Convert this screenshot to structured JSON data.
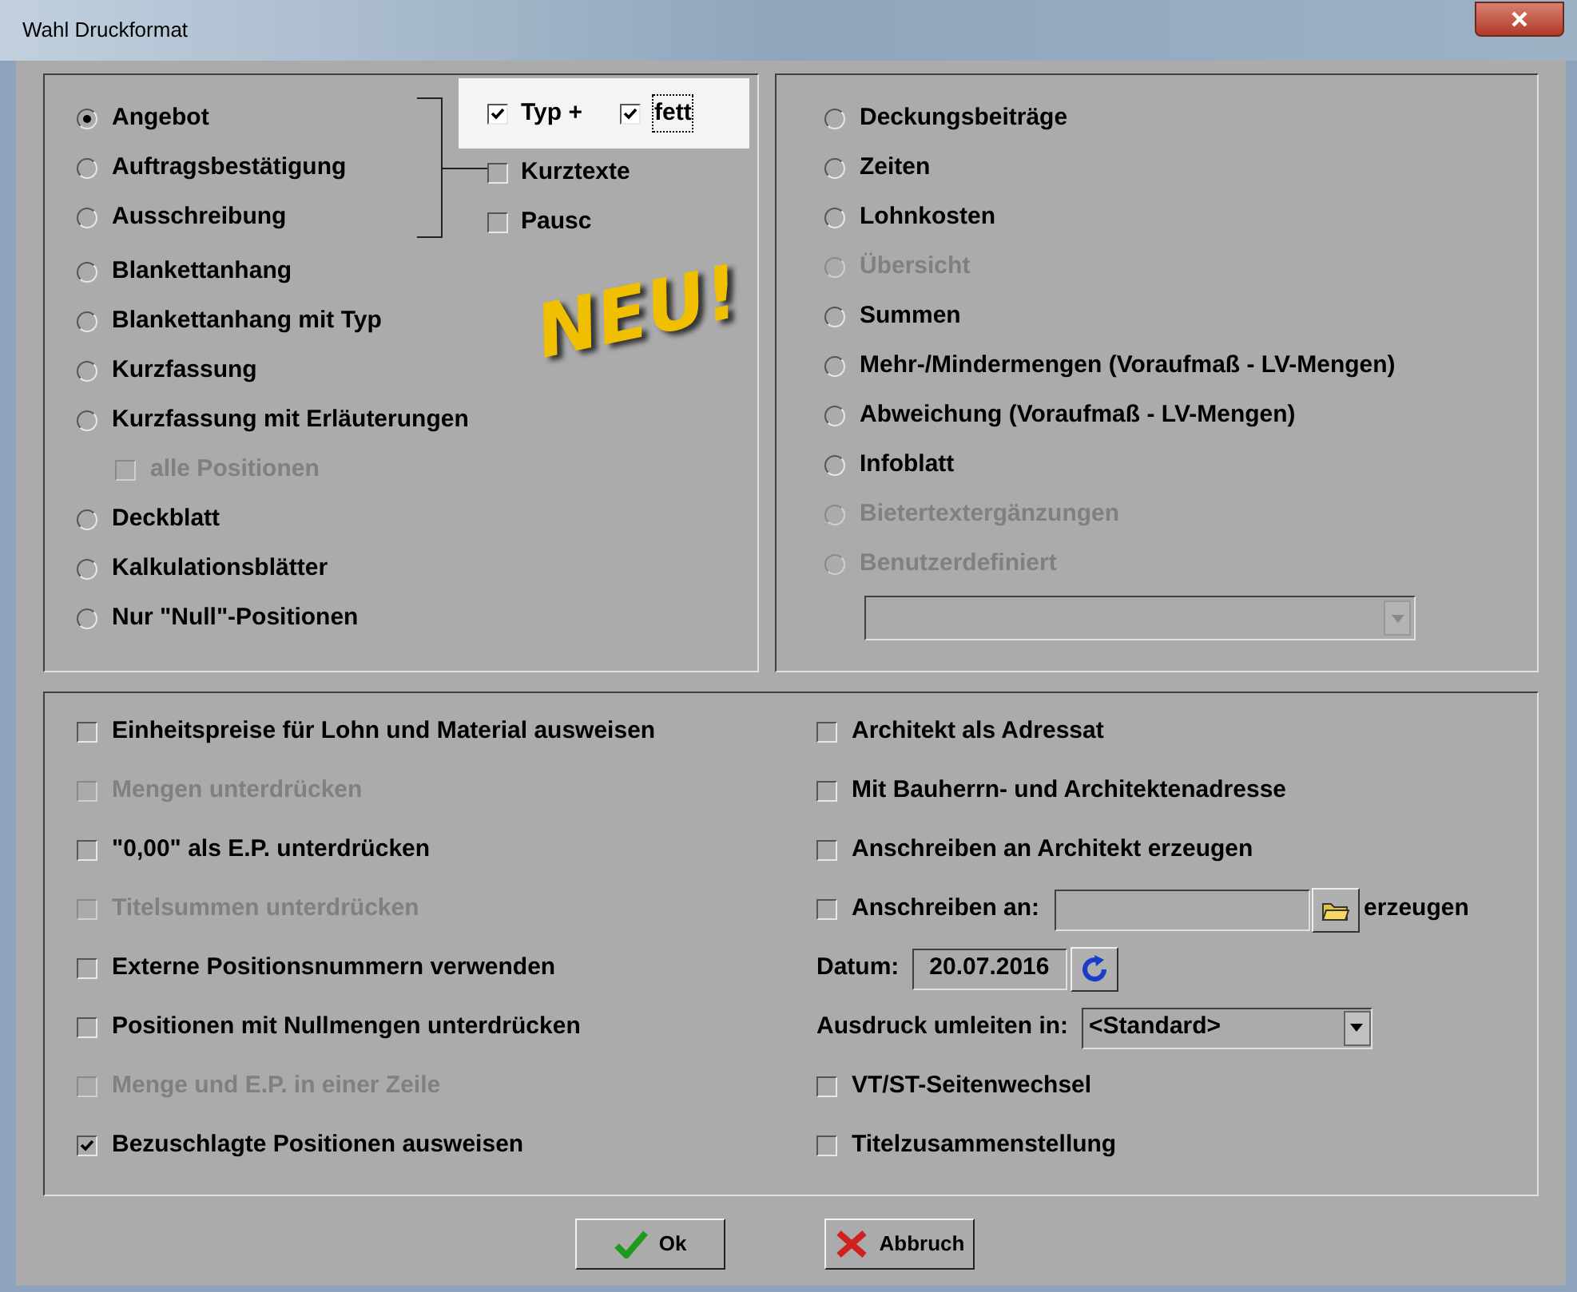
{
  "window": {
    "title": "Wahl Druckformat"
  },
  "top_left": {
    "bracketed": [
      {
        "label": "Angebot",
        "selected": true
      },
      {
        "label": "Auftragsbestätigung",
        "selected": false
      },
      {
        "label": "Ausschreibung",
        "selected": false
      }
    ],
    "type_options": [
      {
        "label": "Typ +",
        "checked": true,
        "highlighted": true,
        "focused": false
      },
      {
        "label": "fett",
        "checked": true,
        "highlighted": true,
        "focused": true
      },
      {
        "label": "Kurztexte",
        "checked": false,
        "highlighted": false,
        "focused": false
      },
      {
        "label": "Pausc",
        "checked": false,
        "highlighted": false,
        "focused": false
      }
    ],
    "options": [
      {
        "label": "Blankettanhang",
        "selected": false
      },
      {
        "label": "Blankettanhang mit Typ",
        "selected": false
      },
      {
        "label": "Kurzfassung",
        "selected": false
      },
      {
        "label": "Kurzfassung mit Erläuterungen",
        "selected": false,
        "children": [
          {
            "label": "alle Positionen",
            "checked": false,
            "disabled": true
          }
        ]
      },
      {
        "label": "Deckblatt",
        "selected": false
      },
      {
        "label": "Kalkulationsblätter",
        "selected": false
      },
      {
        "label": "Nur \"Null\"-Positionen",
        "selected": false
      }
    ]
  },
  "sticker": {
    "text": "NEU!"
  },
  "top_right": {
    "options": [
      {
        "label": "Deckungsbeiträge",
        "selected": false,
        "disabled": false
      },
      {
        "label": "Zeiten",
        "selected": false,
        "disabled": false
      },
      {
        "label": "Lohnkosten",
        "selected": false,
        "disabled": false
      },
      {
        "label": "Übersicht",
        "selected": false,
        "disabled": true
      },
      {
        "label": "Summen",
        "selected": false,
        "disabled": false
      },
      {
        "label": "Mehr-/Mindermengen (Voraufmaß - LV-Mengen)",
        "selected": false,
        "disabled": false
      },
      {
        "label": "Abweichung (Voraufmaß - LV-Mengen)",
        "selected": false,
        "disabled": false
      },
      {
        "label": "Infoblatt",
        "selected": false,
        "disabled": false
      },
      {
        "label": "Bietertextergänzungen",
        "selected": false,
        "disabled": true
      },
      {
        "label": "Benutzerdefiniert",
        "selected": false,
        "disabled": true
      }
    ],
    "combo": {
      "disabled": true
    }
  },
  "bottom_left": [
    {
      "label": "Einheitspreise für Lohn und Material ausweisen",
      "checked": false,
      "disabled": false
    },
    {
      "label": "Mengen unterdrücken",
      "checked": false,
      "disabled": true
    },
    {
      "label": "\"0,00\" als E.P. unterdrücken",
      "checked": false,
      "disabled": false
    },
    {
      "label": "Titelsummen unterdrücken",
      "checked": false,
      "disabled": true
    },
    {
      "label": "Externe Positionsnummern verwenden",
      "checked": false,
      "disabled": false
    },
    {
      "label": "Positionen mit Nullmengen unterdrücken",
      "checked": false,
      "disabled": false
    },
    {
      "label": "Menge und E.P. in einer Zeile",
      "checked": false,
      "disabled": true
    },
    {
      "label": "Bezuschlagte Positionen ausweisen",
      "checked": true,
      "disabled": false
    }
  ],
  "bottom_right": [
    {
      "kind": "checkbox",
      "label": "Architekt als Adressat",
      "checked": false
    },
    {
      "kind": "checkbox",
      "label": "Mit Bauherrn- und Architektenadresse",
      "checked": false
    },
    {
      "kind": "checkbox",
      "label": "Anschreiben an Architekt erzeugen",
      "checked": false
    },
    {
      "kind": "letter",
      "label": "Anschreiben an:",
      "checked": false,
      "suffix": "erzeugen"
    },
    {
      "kind": "date",
      "label": "Datum:",
      "value": "20.07.2016"
    },
    {
      "kind": "dropdown",
      "label": "Ausdruck umleiten in:",
      "value": "<Standard>"
    },
    {
      "kind": "checkbox",
      "label": "VT/ST-Seitenwechsel",
      "checked": false
    },
    {
      "kind": "checkbox",
      "label": "Titelzusammenstellung",
      "checked": false
    }
  ],
  "buttons": [
    {
      "kind": "ok",
      "label": "Ok"
    },
    {
      "kind": "cancel",
      "label": "Abbruch"
    }
  ]
}
